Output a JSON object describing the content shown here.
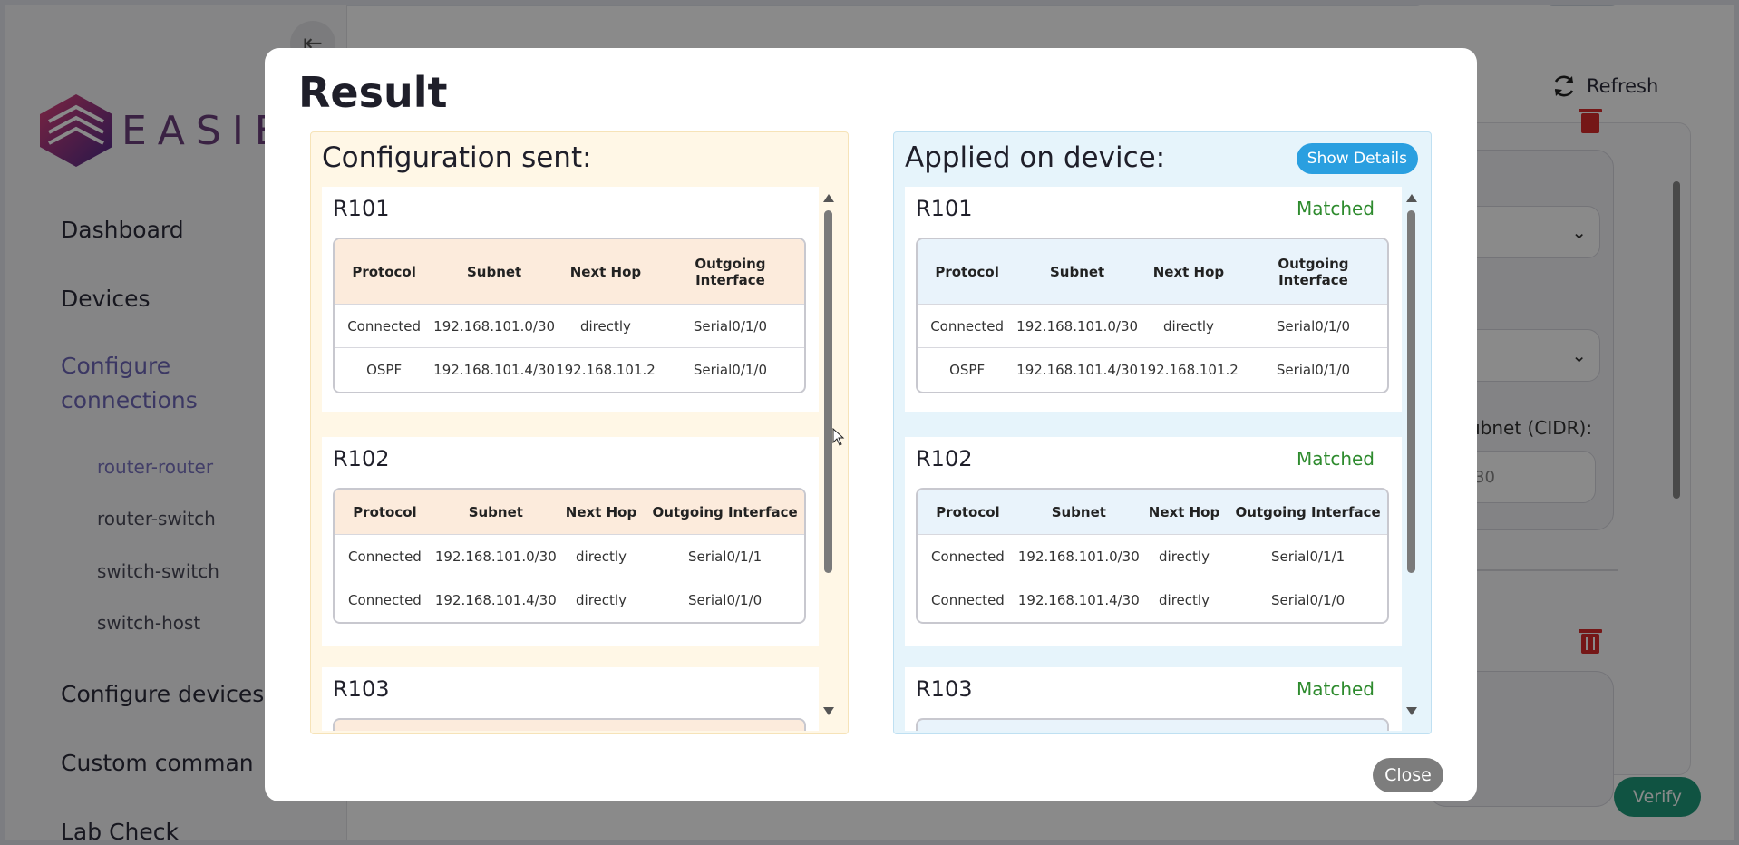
{
  "sidebar": {
    "logo_text": "EASIBL",
    "nav": {
      "dashboard": "Dashboard",
      "devices": "Devices",
      "configure_connections": "Configure connections",
      "configure_devices": "Configure devices",
      "custom_commands": "Custom comman",
      "lab_check": "Lab Check"
    },
    "sub": {
      "router_router": "router-router",
      "router_switch": "router-switch",
      "switch_switch": "switch-switch",
      "switch_host": "switch-host"
    }
  },
  "main": {
    "refresh_label": "Refresh",
    "subnet_label": "ubnet (CIDR):",
    "subnet_value": "30",
    "verify_label": "Verify"
  },
  "modal": {
    "title": "Result",
    "sent_heading": "Configuration sent:",
    "applied_heading": "Applied on device:",
    "show_details_label": "Show Details",
    "close_label": "Close",
    "columns_wrapped": [
      "Protocol",
      "Subnet",
      "Next Hop",
      "Outgoing Interface"
    ],
    "routers": [
      {
        "name": "R101",
        "status": "Matched",
        "rows": [
          [
            "Connected",
            "192.168.101.0/30",
            "directly",
            "Serial0/1/0"
          ],
          [
            "OSPF",
            "192.168.101.4/30",
            "192.168.101.2",
            "Serial0/1/0"
          ]
        ]
      },
      {
        "name": "R102",
        "status": "Matched",
        "rows": [
          [
            "Connected",
            "192.168.101.0/30",
            "directly",
            "Serial0/1/1"
          ],
          [
            "Connected",
            "192.168.101.4/30",
            "directly",
            "Serial0/1/0"
          ]
        ]
      },
      {
        "name": "R103",
        "status": "Matched",
        "rows": []
      }
    ]
  },
  "colors": {
    "sent_bg": "#fff7e6",
    "applied_bg": "#e6f4fb",
    "matched": "#2e8b2e",
    "show_details": "#2a9fe0",
    "active_nav": "#6e67b8",
    "verify": "#1f9a7a"
  }
}
